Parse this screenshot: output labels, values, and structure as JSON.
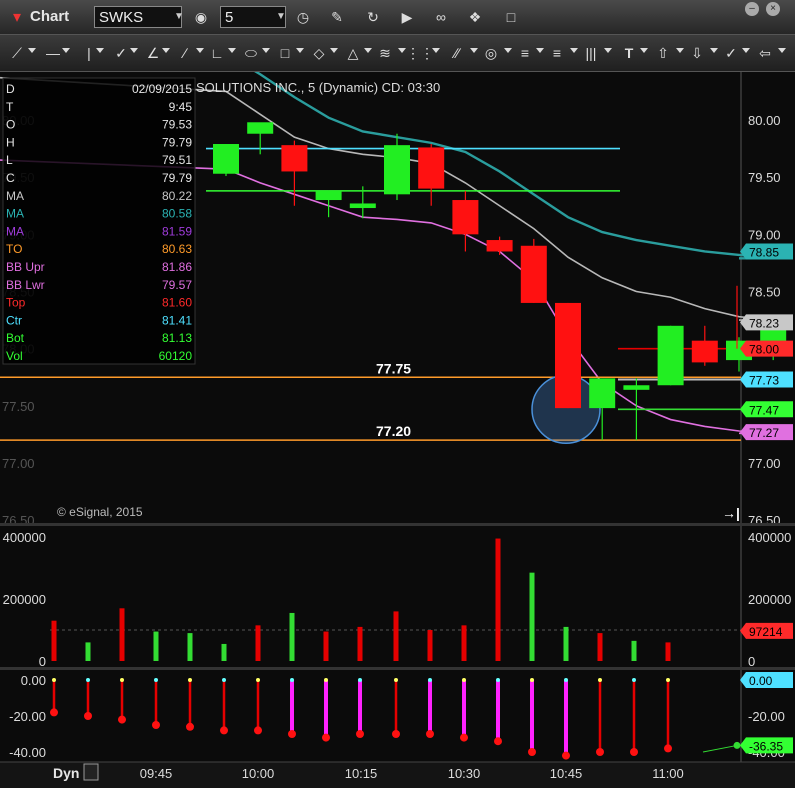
{
  "window": {
    "title": "Chart",
    "symbol": "SWKS",
    "interval": "5",
    "chart_title": "SOLUTIONS INC., 5 (Dynamic) CD: 03:30",
    "watermark": "© eSignal, 2015",
    "dyn_label": "Dyn"
  },
  "data_window": {
    "rows": [
      {
        "label": "D",
        "value": "02/09/2015",
        "color": "#e6e6e6"
      },
      {
        "label": "T",
        "value": "9:45",
        "color": "#e6e6e6"
      },
      {
        "label": "O",
        "value": "79.53",
        "color": "#e6e6e6"
      },
      {
        "label": "H",
        "value": "79.79",
        "color": "#e6e6e6"
      },
      {
        "label": "L",
        "value": "79.51",
        "color": "#e6e6e6"
      },
      {
        "label": "C",
        "value": "79.79",
        "color": "#e6e6e6"
      },
      {
        "label": "MA",
        "value": "80.22",
        "color": "#c8c8c8"
      },
      {
        "label": "MA",
        "value": "80.58",
        "color": "#2bb3b3"
      },
      {
        "label": "MA",
        "value": "81.59",
        "color": "#a03cdc"
      },
      {
        "label": "TO",
        "value": "80.63",
        "color": "#ff9b2a"
      },
      {
        "label": "BB Upr",
        "value": "81.86",
        "color": "#e070e0"
      },
      {
        "label": "BB Lwr",
        "value": "79.57",
        "color": "#e070e0"
      },
      {
        "label": "Top",
        "value": "81.60",
        "color": "#ff2a2a"
      },
      {
        "label": "Ctr",
        "value": "81.41",
        "color": "#4ee0ff"
      },
      {
        "label": "Bot",
        "value": "81.13",
        "color": "#33ff33"
      },
      {
        "label": "Vol",
        "value": "60120",
        "color": "#33ff33"
      }
    ]
  },
  "chart_data": [
    {
      "type": "candlestick",
      "title": "SOLUTIONS INC., 5 (Dynamic) CD: 03:30",
      "x": [
        "9:45",
        "9:50",
        "9:55",
        "10:00",
        "10:05",
        "10:10",
        "10:15",
        "10:20",
        "10:25",
        "10:30",
        "10:35",
        "10:40",
        "10:45",
        "10:50",
        "10:55",
        "11:00",
        "11:05"
      ],
      "open": [
        79.53,
        79.88,
        79.78,
        79.3,
        79.23,
        79.35,
        79.76,
        79.3,
        78.95,
        78.9,
        78.4,
        77.48,
        77.64,
        77.68,
        78.07,
        77.9,
        78.0
      ],
      "high": [
        79.79,
        79.96,
        79.82,
        79.38,
        79.42,
        79.88,
        79.79,
        79.38,
        78.98,
        78.96,
        78.4,
        77.48,
        77.74,
        78.2,
        78.2,
        78.1,
        78.25
      ],
      "low": [
        79.51,
        79.7,
        79.25,
        79.15,
        79.14,
        79.3,
        79.25,
        78.85,
        78.82,
        78.4,
        77.48,
        77.2,
        77.2,
        77.68,
        77.85,
        77.8,
        77.9
      ],
      "close": [
        79.79,
        79.98,
        79.55,
        79.38,
        79.27,
        79.78,
        79.4,
        79.0,
        78.85,
        78.4,
        77.48,
        77.74,
        77.68,
        78.2,
        77.88,
        78.07,
        78.23
      ],
      "moving_averages": {
        "gray": [
          80.25,
          80.05,
          79.85,
          79.75,
          79.7,
          79.67,
          79.62,
          79.45,
          79.25,
          79.05,
          78.8,
          78.62,
          78.5,
          78.45,
          78.35,
          78.28,
          78.25
        ],
        "teal": [
          80.58,
          80.4,
          80.2,
          80.02,
          79.9,
          79.85,
          79.8,
          79.72,
          79.55,
          79.35,
          79.15,
          79.02,
          78.95,
          78.9,
          78.85,
          78.82,
          78.79
        ],
        "pink": [
          79.57,
          79.45,
          79.35,
          79.25,
          79.15,
          79.13,
          79.1,
          79.0,
          78.85,
          78.6,
          78.1,
          77.7,
          77.5,
          77.38,
          77.32,
          77.28,
          77.26
        ]
      },
      "horizontal_levels": [
        {
          "label": "77.75",
          "value": 77.75,
          "color": "#ff9b2a"
        },
        {
          "label": "77.20",
          "value": 77.2,
          "color": "#ff9b2a"
        },
        {
          "label": "",
          "value": 79.75,
          "color": "#4ee0ff"
        },
        {
          "label": "",
          "value": 79.38,
          "color": "#33ff33"
        }
      ],
      "ylim": [
        76.5,
        80.5
      ],
      "yticks": [
        "80.00",
        "79.50",
        "79.00",
        "78.50",
        "78.00",
        "77.50",
        "77.00",
        "76.50"
      ],
      "price_tags": [
        {
          "text": "78.85",
          "color": "#2bb3b3"
        },
        {
          "text": "78.23",
          "color": "#c8c8c8"
        },
        {
          "text": "78.00",
          "color": "#ff2a2a"
        },
        {
          "text": "77.73",
          "color": "#4ee0ff"
        },
        {
          "text": "77.47",
          "color": "#33ff33"
        },
        {
          "text": "77.27",
          "color": "#e070e0"
        }
      ],
      "x_ticks": [
        "09:45",
        "10:00",
        "10:15",
        "10:30",
        "10:45",
        "11:00"
      ]
    },
    {
      "type": "bar",
      "title": "Volume",
      "values": [
        130000,
        60000,
        170000,
        95000,
        90000,
        55000,
        115000,
        155000,
        95000,
        110000,
        160000,
        100000,
        115000,
        395000,
        285000,
        110000,
        90000,
        65000,
        60000
      ],
      "colors": [
        "red",
        "green",
        "red",
        "green",
        "green",
        "green",
        "red",
        "green",
        "red",
        "red",
        "red",
        "red",
        "red",
        "red",
        "green",
        "green",
        "red",
        "green",
        "red"
      ],
      "ylim": [
        0,
        420000
      ],
      "yticks": [
        "400000",
        "200000",
        "0"
      ],
      "last_tag": {
        "text": "97214",
        "color": "#ff2a2a"
      }
    },
    {
      "type": "bar",
      "title": "Oscillator",
      "values": [
        -18,
        -20,
        -22,
        -25,
        -26,
        -28,
        -28,
        -30,
        -32,
        -30,
        -30,
        -30,
        -32,
        -34,
        -40,
        -42,
        -40,
        -40,
        -38
      ],
      "colors": [
        "red",
        "red",
        "red",
        "red",
        "red",
        "red",
        "red",
        "magenta",
        "magenta",
        "magenta",
        "red",
        "magenta",
        "magenta",
        "magenta",
        "magenta",
        "magenta",
        "red",
        "red",
        "red"
      ],
      "ylim": [
        -45,
        5
      ],
      "yticks": [
        "0.00",
        "-20.00",
        "-40.00"
      ],
      "right_ticks": [
        "-20.00",
        "-40.00"
      ],
      "tags": [
        {
          "text": "0.00",
          "color": "#4ee0ff"
        },
        {
          "text": "-36.35",
          "color": "#33ff33"
        }
      ]
    }
  ]
}
